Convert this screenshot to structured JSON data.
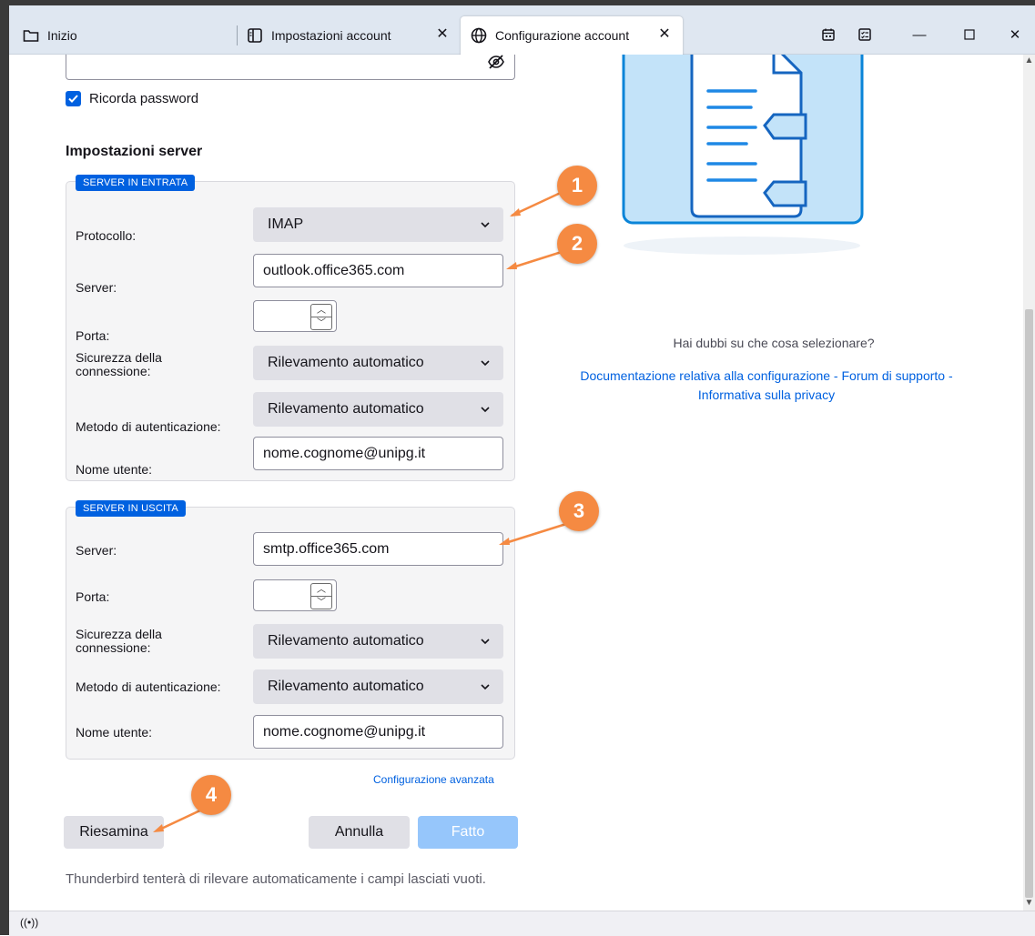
{
  "tabs": [
    {
      "label": "Inizio",
      "icon": "folder-icon"
    },
    {
      "label": "Impostazioni account",
      "icon": "settings-book-icon"
    },
    {
      "label": "Configurazione account",
      "icon": "globe-icon"
    }
  ],
  "password": {
    "toggle_icon": "eye-slash-icon"
  },
  "remember_password_label": "Ricorda password",
  "server_settings_heading": "Impostazioni server",
  "incoming": {
    "legend": "SERVER IN ENTRATA",
    "protocol_label": "Protocollo:",
    "protocol_value": "IMAP",
    "server_label": "Server:",
    "server_value": "outlook.office365.com",
    "port_label": "Porta:",
    "security_label": "Sicurezza della connessione:",
    "security_value": "Rilevamento automatico",
    "auth_label": "Metodo di autenticazione:",
    "auth_value": "Rilevamento automatico",
    "username_label": "Nome utente:",
    "username_value": "nome.cognome@unipg.it"
  },
  "outgoing": {
    "legend": "SERVER IN USCITA",
    "server_label": "Server:",
    "server_value": "smtp.office365.com",
    "port_label": "Porta:",
    "security_label": "Sicurezza della connessione:",
    "security_value": "Rilevamento automatico",
    "auth_label": "Metodo di autenticazione:",
    "auth_value": "Rilevamento automatico",
    "username_label": "Nome utente:",
    "username_value": "nome.cognome@unipg.it"
  },
  "advanced_link": "Configurazione avanzata",
  "buttons": {
    "review": "Riesamina",
    "cancel": "Annulla",
    "done": "Fatto"
  },
  "hint": "Thunderbird tenterà di rilevare automaticamente i campi lasciati vuoti.",
  "help": {
    "question": "Hai dubbi su che cosa selezionare?",
    "links_line1": "Documentazione relativa alla configurazione - Forum di supporto -",
    "links_line2": "Informativa sulla privacy"
  },
  "annotations": [
    "1",
    "2",
    "3",
    "4"
  ],
  "colors": {
    "accent": "#0061e0",
    "annotation": "#f58a42",
    "done_disabled": "#96c6fb"
  }
}
